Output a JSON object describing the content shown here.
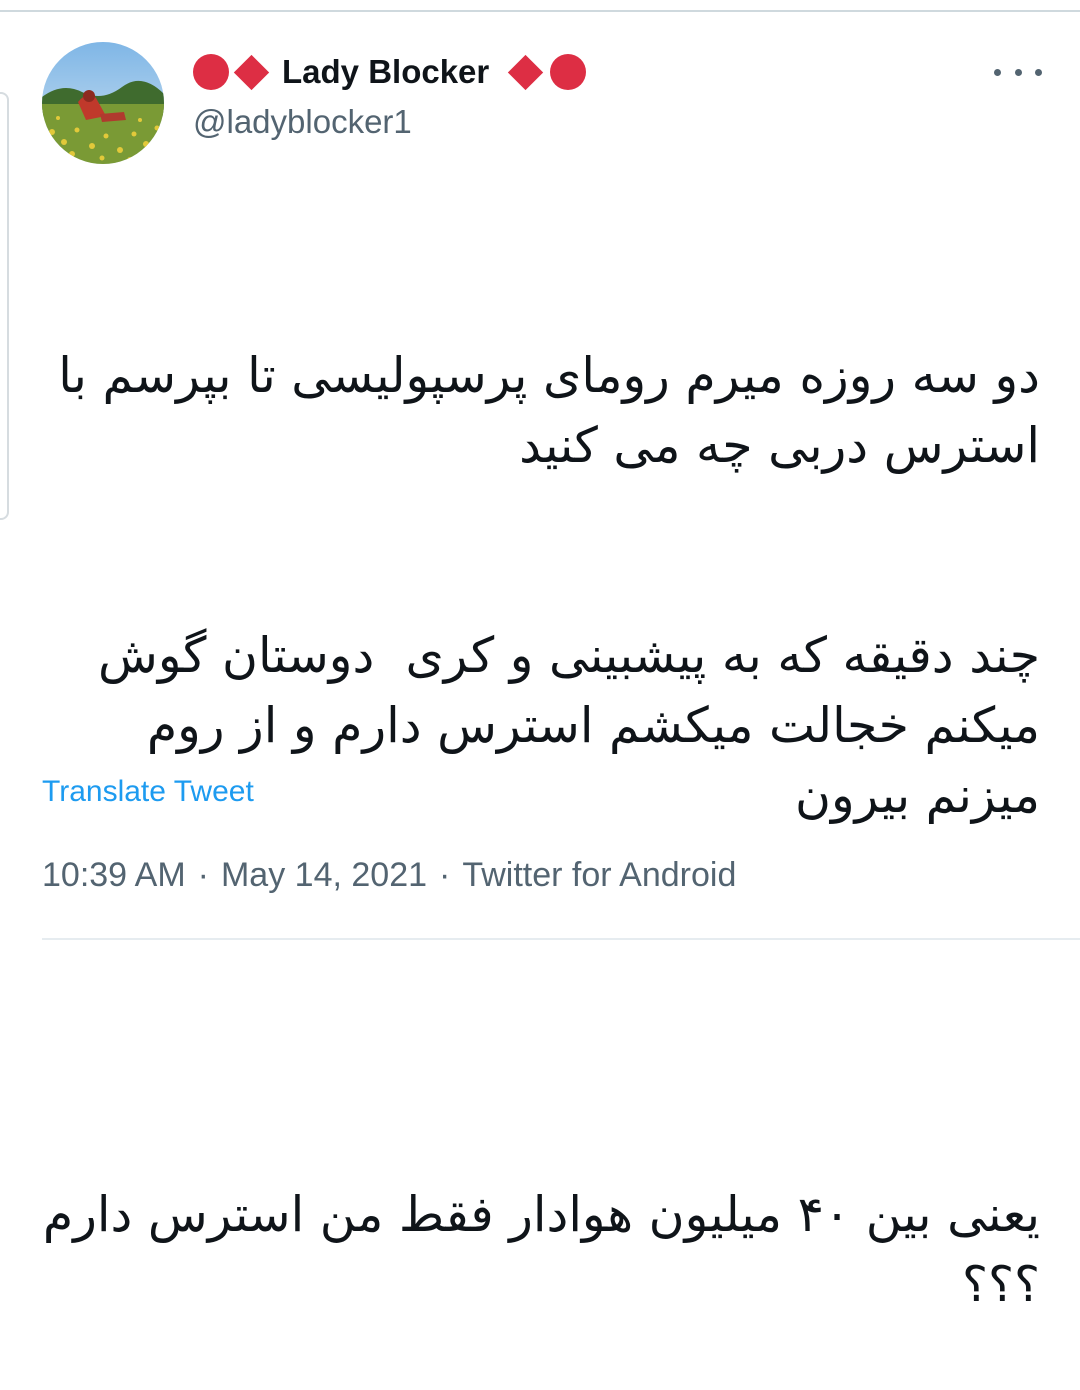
{
  "tweet": {
    "author": {
      "display_name": "Lady Blocker",
      "handle": "@ladyblocker1",
      "name_emoji_left": [
        "red-circle",
        "red-diamond"
      ],
      "name_emoji_right": [
        "red-diamond",
        "red-circle"
      ]
    },
    "text_paragraphs": [
      "دو سه روزه میرم رومای پرسپولیسی تا بپرسم با استرس دربی چه می کنید",
      "چند دقیقه که به پیشبینی و کری  دوستان گوش میکنم خجالت میکشم استرس دارم و از روم میزنم بیرون",
      "یعنی بین ۴۰ میلیون هوادار فقط من استرس دارم ؟؟؟"
    ],
    "translate_label": "Translate Tweet",
    "time": "10:39 AM",
    "date": "May 14, 2021",
    "source": "Twitter for Android",
    "separator": "·"
  },
  "colors": {
    "accent": "#1d9bf0",
    "emoji_red": "#dd2e44",
    "secondary_text": "#536471",
    "primary_text": "#0f1419"
  },
  "icons": {
    "more": "more-horizontal-icon"
  }
}
